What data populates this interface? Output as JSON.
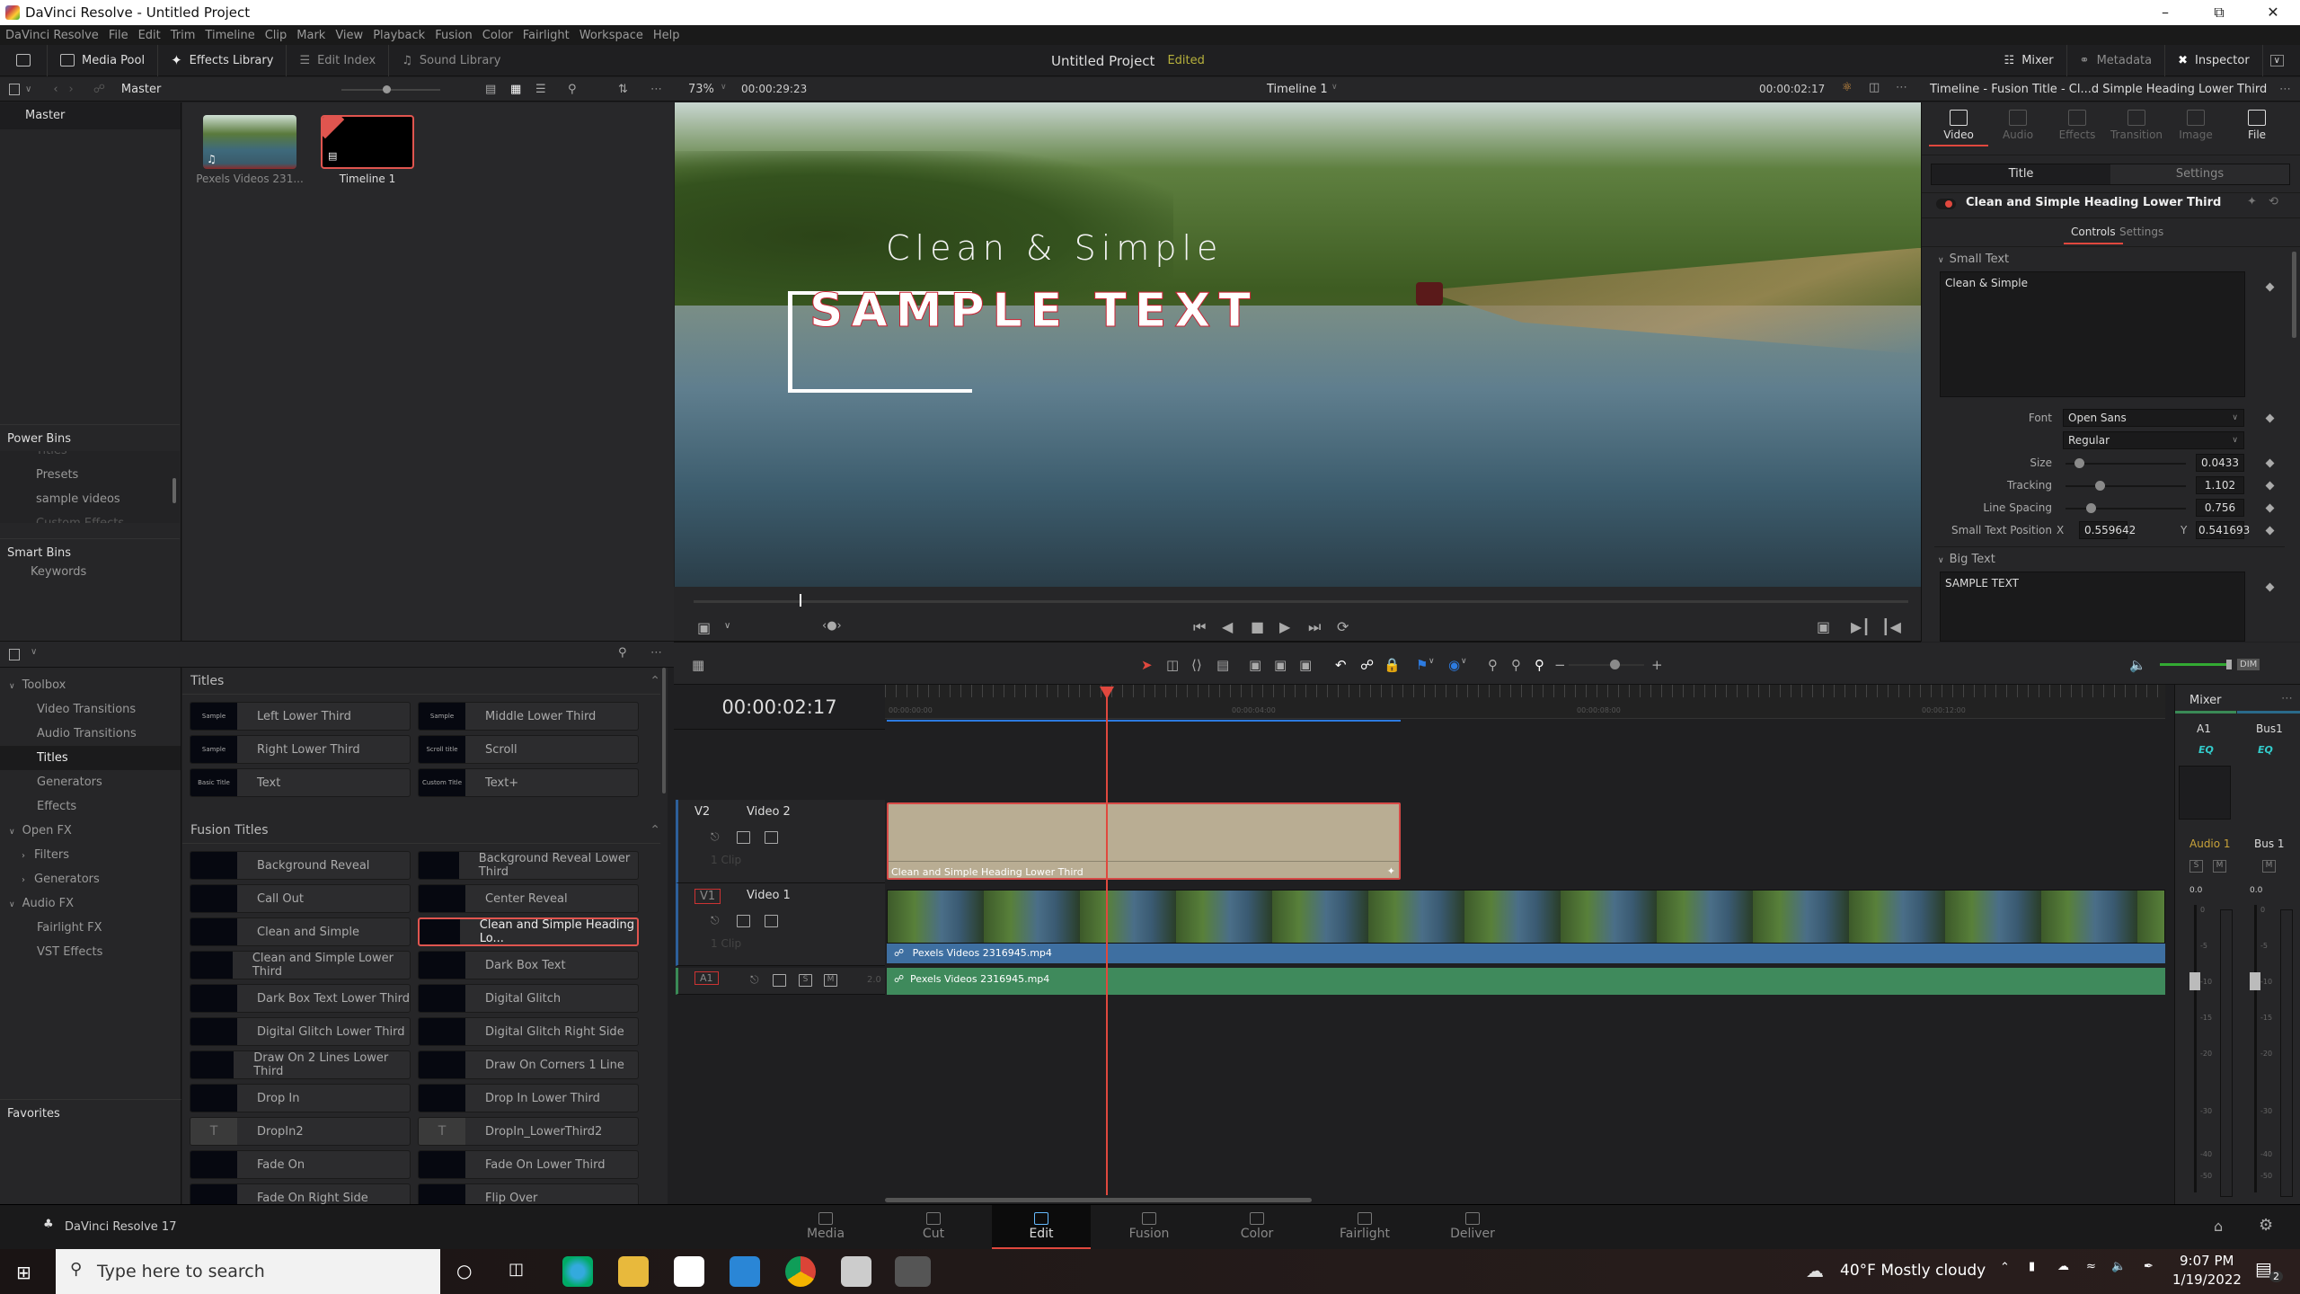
{
  "window": {
    "title": "DaVinci Resolve - Untitled Project",
    "controls": [
      "minimize",
      "maximize",
      "close"
    ]
  },
  "menu": [
    "DaVinci Resolve",
    "File",
    "Edit",
    "Trim",
    "Timeline",
    "Clip",
    "Mark",
    "View",
    "Playback",
    "Fusion",
    "Color",
    "Fairlight",
    "Workspace",
    "Help"
  ],
  "toolbar": {
    "media_pool": "Media Pool",
    "effects_library": "Effects Library",
    "edit_index": "Edit Index",
    "sound_library": "Sound Library",
    "project_name": "Untitled Project",
    "project_status": "Edited",
    "mixer": "Mixer",
    "metadata": "Metadata",
    "inspector": "Inspector"
  },
  "media_pool": {
    "bin_name": "Master",
    "bins": {
      "master": "Master"
    },
    "clips": [
      {
        "name": "Pexels Videos 231...",
        "type": "video"
      },
      {
        "name": "Timeline 1",
        "type": "timeline",
        "selected": true
      }
    ],
    "power_bins": {
      "heading": "Power Bins",
      "items": [
        "Titles",
        "Presets",
        "sample videos",
        "Custom Effects"
      ]
    },
    "smart_bins": {
      "heading": "Smart Bins",
      "items": [
        "Keywords"
      ]
    }
  },
  "effects": {
    "tree": [
      {
        "label": "Toolbox",
        "level": 0,
        "expanded": true
      },
      {
        "label": "Video Transitions",
        "level": 1
      },
      {
        "label": "Audio Transitions",
        "level": 1
      },
      {
        "label": "Titles",
        "level": 1,
        "selected": true
      },
      {
        "label": "Generators",
        "level": 1
      },
      {
        "label": "Effects",
        "level": 1
      },
      {
        "label": "Open FX",
        "level": 0,
        "expanded": true
      },
      {
        "label": "Filters",
        "level": 1,
        "collapsed": true
      },
      {
        "label": "Generators",
        "level": 1,
        "collapsed": true
      },
      {
        "label": "Audio FX",
        "level": 0,
        "expanded": true
      },
      {
        "label": "Fairlight FX",
        "level": 1
      },
      {
        "label": "VST Effects",
        "level": 1
      }
    ],
    "favorites": "Favorites",
    "titles_heading": "Titles",
    "titles": [
      {
        "name": "Left Lower Third",
        "thumb": "Sample"
      },
      {
        "name": "Middle Lower Third",
        "thumb": "Sample"
      },
      {
        "name": "Right Lower Third",
        "thumb": "Sample"
      },
      {
        "name": "Scroll",
        "thumb": "Scroll title"
      },
      {
        "name": "Text",
        "thumb": "Basic Title"
      },
      {
        "name": "Text+",
        "thumb": "Custom Title"
      }
    ],
    "fusion_heading": "Fusion Titles",
    "fusion_titles": [
      {
        "name": "Background Reveal"
      },
      {
        "name": "Background Reveal Lower Third"
      },
      {
        "name": "Call Out"
      },
      {
        "name": "Center Reveal"
      },
      {
        "name": "Clean and Simple"
      },
      {
        "name": "Clean and Simple Heading Lo...",
        "selected": true
      },
      {
        "name": "Clean and Simple Lower Third"
      },
      {
        "name": "Dark Box Text"
      },
      {
        "name": "Dark Box Text Lower Third"
      },
      {
        "name": "Digital Glitch"
      },
      {
        "name": "Digital Glitch Lower Third"
      },
      {
        "name": "Digital Glitch Right Side"
      },
      {
        "name": "Draw On 2 Lines Lower Third"
      },
      {
        "name": "Draw On Corners 1 Line"
      },
      {
        "name": "Drop In"
      },
      {
        "name": "Drop In Lower Third"
      },
      {
        "name": "DropIn2",
        "generic": true
      },
      {
        "name": "DropIn_LowerThird2",
        "generic": true
      },
      {
        "name": "Fade On"
      },
      {
        "name": "Fade On Lower Third"
      },
      {
        "name": "Fade On Right Side"
      },
      {
        "name": "Flip Over"
      }
    ]
  },
  "viewer": {
    "zoom": "73%",
    "source_duration": "00:00:29:23",
    "timeline_name": "Timeline 1",
    "timecode": "00:00:02:17",
    "overlay_small": "Clean & Simple",
    "overlay_big": "SAMPLE TEXT"
  },
  "inspector": {
    "header": "Timeline - Fusion Title - Cl...d Simple Heading Lower Third",
    "tabs": [
      {
        "label": "Video",
        "active": true
      },
      {
        "label": "Audio"
      },
      {
        "label": "Effects"
      },
      {
        "label": "Transition"
      },
      {
        "label": "Image"
      },
      {
        "label": "File"
      }
    ],
    "segment": [
      "Title",
      "Settings"
    ],
    "title_name": "Clean and Simple Heading Lower Third",
    "subtabs": [
      "Controls",
      "Settings"
    ],
    "small_text": {
      "heading": "Small Text",
      "value": "Clean & Simple",
      "font_label": "Font",
      "font": "Open Sans",
      "style": "Regular",
      "size_label": "Size",
      "size": "0.0433",
      "tracking_label": "Tracking",
      "tracking": "1.102",
      "line_spacing_label": "Line Spacing",
      "line_spacing": "0.756",
      "position_label": "Small Text Position",
      "x_label": "X",
      "x": "0.559642",
      "y_label": "Y",
      "y": "0.541693"
    },
    "big_text": {
      "heading": "Big Text",
      "value": "SAMPLE TEXT"
    }
  },
  "timeline": {
    "timecode": "00:00:02:17",
    "ruler": [
      "00:00:00:00",
      "00:00:04:00",
      "00:00:08:00",
      "00:00:12:00"
    ],
    "tracks": [
      {
        "id": "V2",
        "name": "Video 2",
        "count": "1 Clip"
      },
      {
        "id": "V1",
        "name": "Video 1",
        "count": "1 Clip"
      },
      {
        "id": "A1",
        "name": "",
        "channels": "2.0",
        "solo": "S",
        "mute": "M"
      }
    ],
    "title_clip": "Clean and Simple Heading Lower Third",
    "video_clip": "Pexels Videos 2316945.mp4",
    "audio_clip": "Pexels Videos 2316945.mp4"
  },
  "mixer": {
    "title": "Mixer",
    "channels": [
      "A1",
      "Bus1"
    ],
    "eq": "EQ",
    "strips": [
      {
        "name": "Audio 1",
        "solo": "S",
        "mute": "M",
        "level": "0.0"
      },
      {
        "name": "Bus 1",
        "mute": "M",
        "level": "0.0"
      }
    ],
    "scale": [
      "0",
      "-5",
      "-10",
      "-15",
      "-20",
      "-30",
      "-40",
      "-50"
    ]
  },
  "pages": {
    "app_label": "DaVinci Resolve 17",
    "items": [
      "Media",
      "Cut",
      "Edit",
      "Fusion",
      "Color",
      "Fairlight",
      "Deliver"
    ],
    "active": "Edit"
  },
  "taskbar": {
    "search_placeholder": "Type here to search",
    "weather": "40°F  Mostly cloudy",
    "time": "9:07 PM",
    "date": "1/19/2022",
    "notifications": "2"
  }
}
